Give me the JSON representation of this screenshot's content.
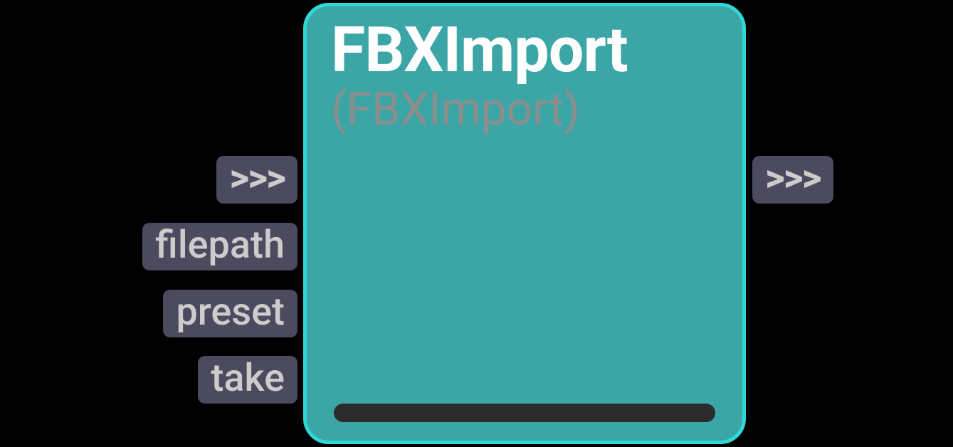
{
  "node": {
    "title": "FBXImport",
    "subtitle": "(FBXImport)"
  },
  "ports": {
    "in_exec": ">>>",
    "in1": "filepath",
    "in2": "preset",
    "in3": "take",
    "out_exec": ">>>"
  }
}
